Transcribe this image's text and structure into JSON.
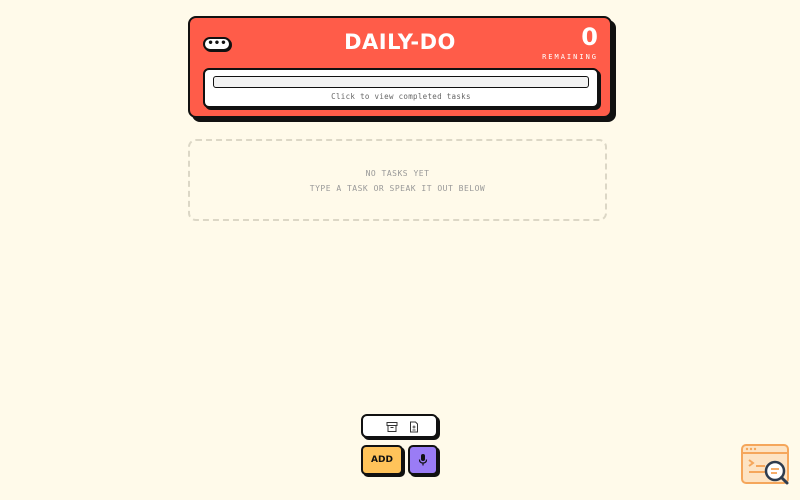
{
  "app": {
    "title": "DAILY-DO",
    "menu_label": "•••"
  },
  "counter": {
    "value": "0",
    "label": "REMAINING"
  },
  "progress": {
    "fraction": 0,
    "hint": "Click to view completed tasks"
  },
  "empty_state": {
    "line1": "NO TASKS YET",
    "line2": "TYPE A TASK OR SPEAK IT OUT BELOW"
  },
  "tools": {
    "archive_icon": "archive-icon",
    "document_icon": "document-icon"
  },
  "actions": {
    "add_label": "ADD",
    "mic_icon": "microphone-icon"
  },
  "widget": {
    "icon": "browser-search-icon"
  },
  "colors": {
    "background": "#fffaea",
    "header": "#ff5c49",
    "add": "#ffc35a",
    "mic": "#9a7cf5",
    "widget": "#f5a65b"
  }
}
